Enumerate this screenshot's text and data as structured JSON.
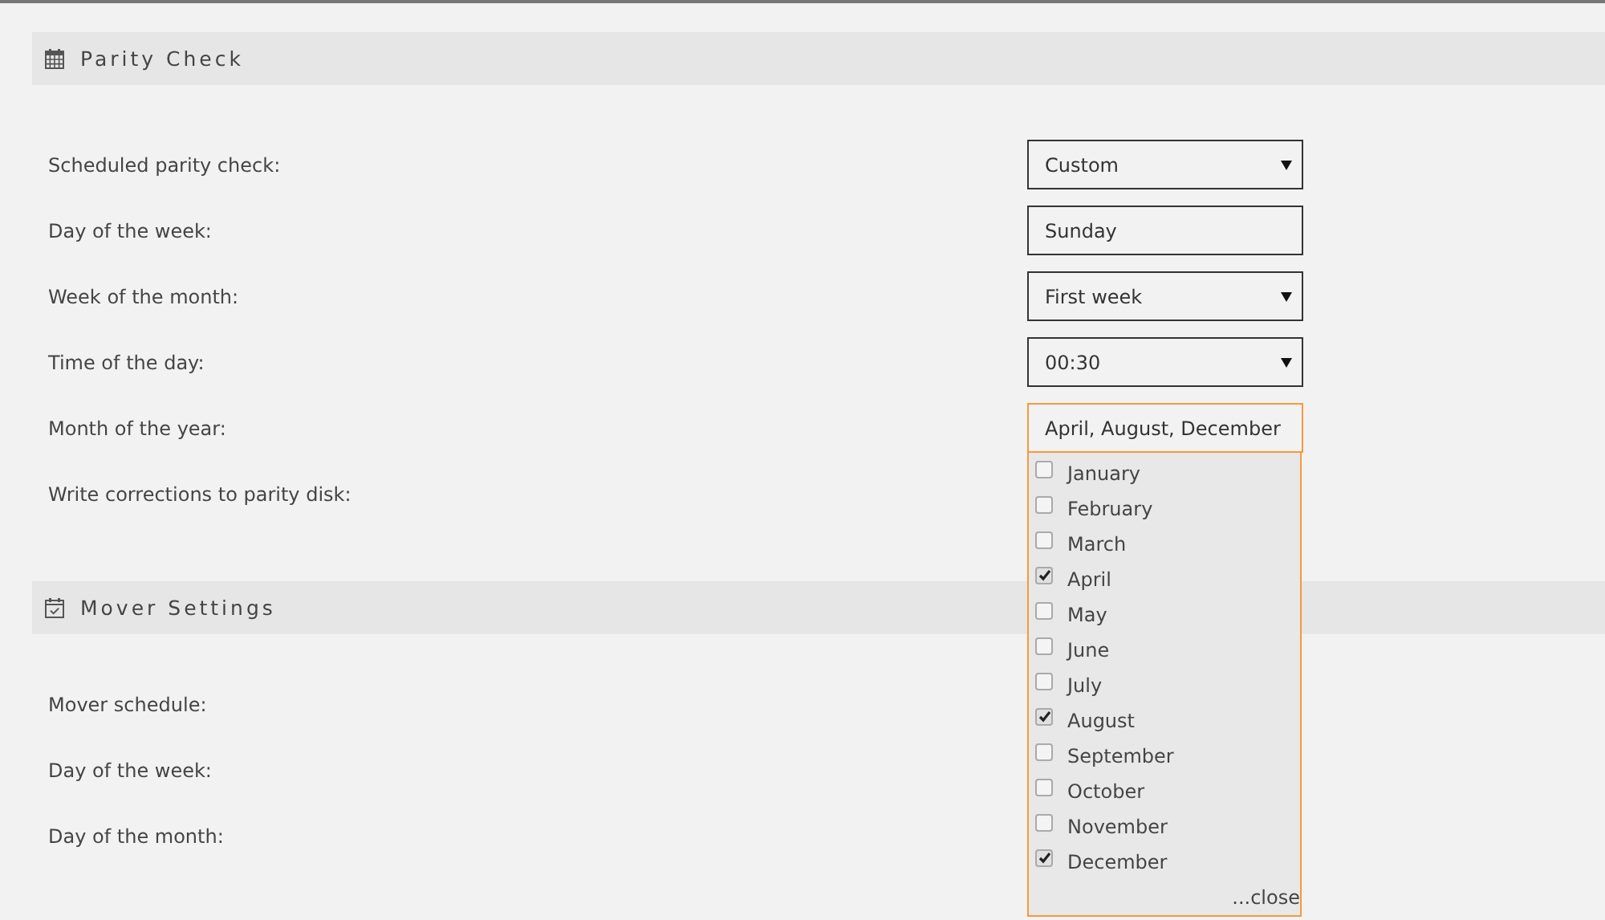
{
  "sections": [
    {
      "title": "Parity Check",
      "rows": [
        {
          "label": "Scheduled parity check:",
          "field": {
            "kind": "select",
            "value": "Custom"
          }
        },
        {
          "label": "Day of the week:",
          "field": {
            "kind": "text",
            "value": "Sunday"
          }
        },
        {
          "label": "Week of the month:",
          "field": {
            "kind": "select",
            "value": "First week"
          }
        },
        {
          "label": "Time of the day:",
          "field": {
            "kind": "select",
            "value": "00:30"
          }
        },
        {
          "label": "Month of the year:",
          "field": {
            "kind": "multiselect",
            "value": "April, August, December",
            "expanded": true,
            "close_label": "...close",
            "options": [
              {
                "label": "January",
                "checked": false
              },
              {
                "label": "February",
                "checked": false
              },
              {
                "label": "March",
                "checked": false
              },
              {
                "label": "April",
                "checked": true
              },
              {
                "label": "May",
                "checked": false
              },
              {
                "label": "June",
                "checked": false
              },
              {
                "label": "July",
                "checked": false
              },
              {
                "label": "August",
                "checked": true
              },
              {
                "label": "September",
                "checked": false
              },
              {
                "label": "October",
                "checked": false
              },
              {
                "label": "November",
                "checked": false
              },
              {
                "label": "December",
                "checked": true
              }
            ]
          }
        },
        {
          "label": "Write corrections to parity disk:"
        }
      ]
    },
    {
      "title": "Mover Settings",
      "rows": [
        {
          "label": "Mover schedule:"
        },
        {
          "label": "Day of the week:"
        },
        {
          "label": "Day of the month:"
        }
      ]
    }
  ]
}
